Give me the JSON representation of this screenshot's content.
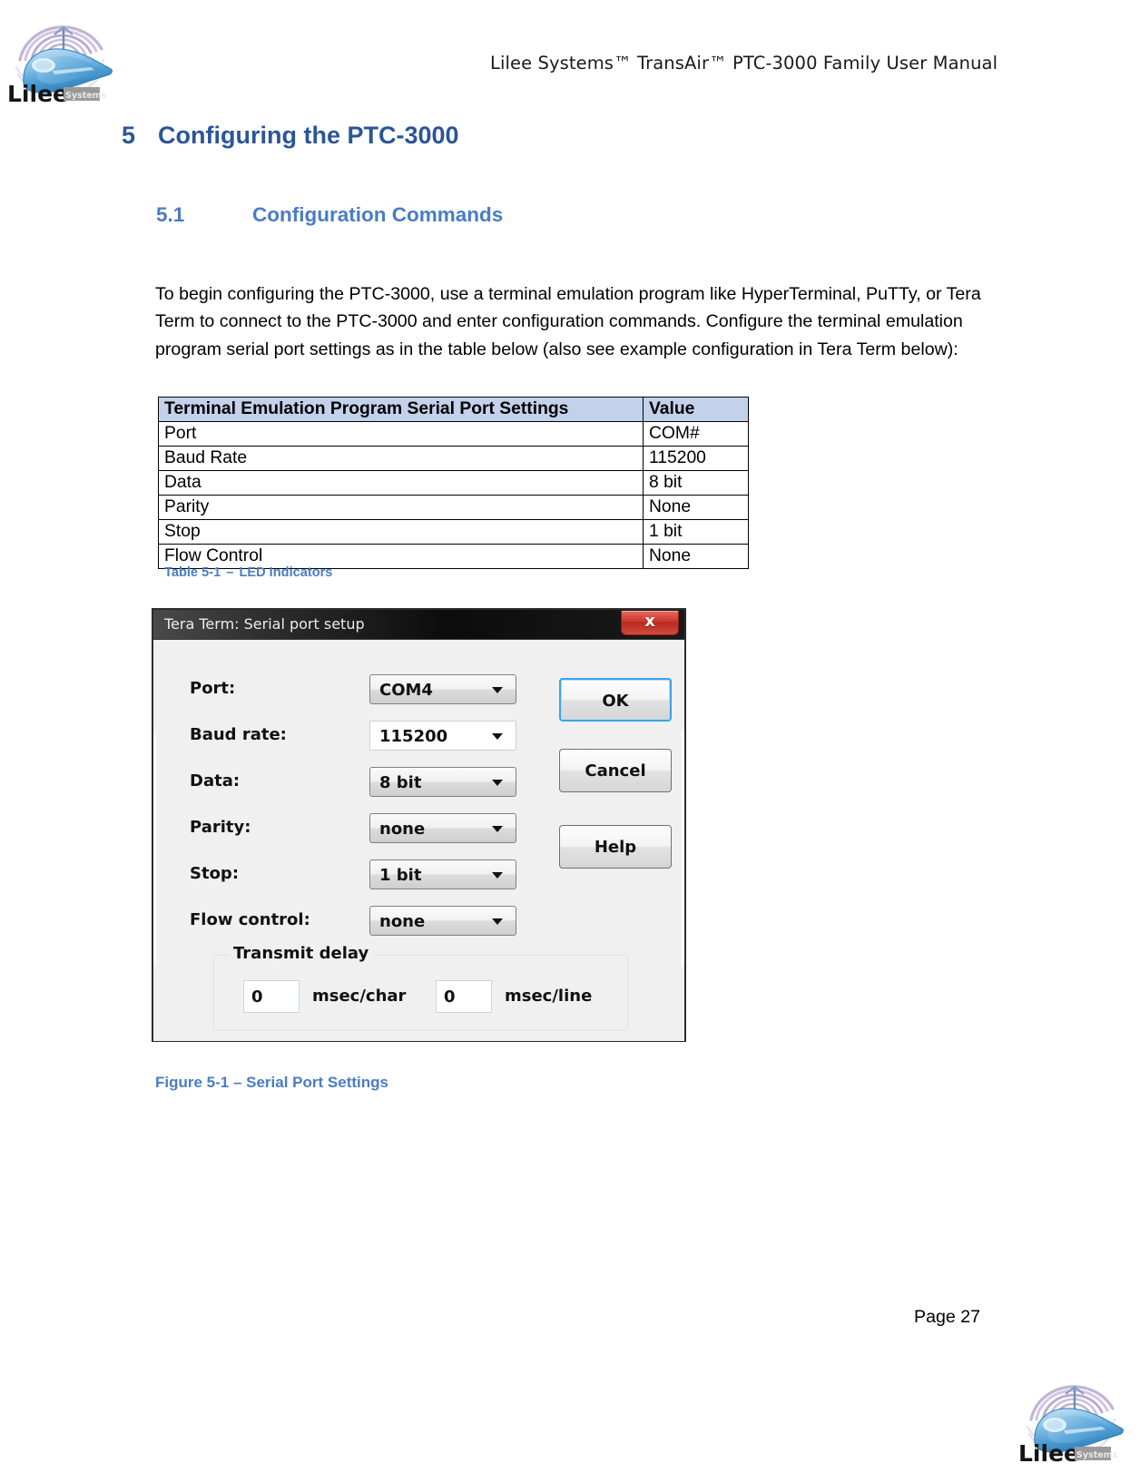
{
  "header": {
    "title": "Lilee Systems™ TransAir™ PTC-3000 Family User Manual",
    "logo_icon": "lilee-train-logo-icon",
    "logo_wordmark": "Lilee",
    "logo_badge": "Systems"
  },
  "headings": {
    "h1_number": "5",
    "h1_text": "Configuring the PTC-3000",
    "h2_number": "5.1",
    "h2_text": "Configuration Commands",
    "h1_color": "#2b5597",
    "h2_color": "#4a7cc4"
  },
  "body": {
    "paragraph": "To begin configuring the PTC-3000, use a terminal emulation program like HyperTerminal, PuTTy, or Tera Term to connect to the PTC-3000 and enter configuration commands. Configure the terminal emulation program serial port settings as in the table below (also see example configuration in Tera Term below):"
  },
  "table": {
    "header_bg": "#c3d2ea",
    "columns": [
      "Terminal Emulation Program Serial Port Settings",
      "Value"
    ],
    "rows": [
      [
        "Port",
        "COM#"
      ],
      [
        "Baud Rate",
        "115200"
      ],
      [
        "Data",
        "8 bit"
      ],
      [
        "Parity",
        "None"
      ],
      [
        "Stop",
        "1 bit"
      ],
      [
        "Flow Control",
        "None"
      ]
    ],
    "caption_label": "Table 5-1",
    "caption_dash": "–",
    "caption_text": "LED Indicators"
  },
  "dialog": {
    "title": "Tera Term: Serial port setup",
    "close_icon": "close-x-icon",
    "close_label": "x",
    "fields": [
      {
        "label": "Port:",
        "value": "COM4",
        "type": "dropdown"
      },
      {
        "label": "Baud rate:",
        "value": "115200",
        "type": "editable-combo"
      },
      {
        "label": "Data:",
        "value": "8 bit",
        "type": "dropdown"
      },
      {
        "label": "Parity:",
        "value": "none",
        "type": "dropdown"
      },
      {
        "label": "Stop:",
        "value": "1 bit",
        "type": "dropdown"
      },
      {
        "label": "Flow control:",
        "value": "none",
        "type": "dropdown"
      }
    ],
    "buttons": [
      {
        "label": "OK",
        "default": true
      },
      {
        "label": "Cancel",
        "default": false
      },
      {
        "label": "Help",
        "default": false
      }
    ],
    "transmit_delay": {
      "group_title": "Transmit delay",
      "char_value": "0",
      "char_unit": "msec/char",
      "line_value": "0",
      "line_unit": "msec/line"
    }
  },
  "figure": {
    "caption": "Figure 5-1 – Serial Port Settings"
  },
  "footer": {
    "page_label": "Page 27",
    "logo_icon": "lilee-train-logo-icon",
    "logo_wordmark": "Lilee",
    "logo_badge": "Systems"
  }
}
